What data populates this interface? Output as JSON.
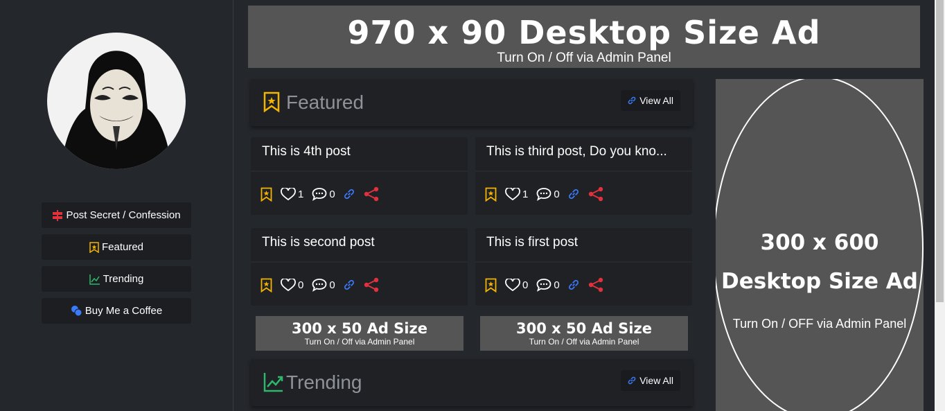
{
  "sidebar": {
    "nav": [
      {
        "label": "Post Secret / Confession",
        "icon": "signpost-icon"
      },
      {
        "label": "Featured",
        "icon": "bookmark-star-icon"
      },
      {
        "label": "Trending",
        "icon": "trending-up-icon"
      },
      {
        "label": "Buy Me a Coffee",
        "icon": "coins-icon"
      }
    ]
  },
  "ads": {
    "top": {
      "title": "970 x 90 Desktop Size Ad",
      "subtitle": "Turn On / Off via Admin Panel"
    },
    "side": {
      "line1": "300 x 600",
      "line2": "Desktop Size Ad",
      "subtitle": "Turn On / OFF via Admin Panel"
    },
    "small": [
      {
        "title": "300 x 50 Ad Size",
        "subtitle": "Turn On / Off via Admin Panel"
      },
      {
        "title": "300 x 50 Ad Size",
        "subtitle": "Turn On / Off via Admin Panel"
      }
    ]
  },
  "featured": {
    "title": "Featured",
    "view_all": "View All",
    "posts": [
      {
        "title": "This is 4th post",
        "likes": "1",
        "comments": "0"
      },
      {
        "title": "This is third post, Do you kno...",
        "likes": "1",
        "comments": "0"
      },
      {
        "title": "This is second post",
        "likes": "0",
        "comments": "0"
      },
      {
        "title": "This is first post",
        "likes": "0",
        "comments": "0"
      }
    ]
  },
  "trending": {
    "title": "Trending",
    "view_all": "View All"
  },
  "colors": {
    "accent_gold": "#f5b400",
    "share_red": "#e0313d",
    "link_blue": "#3a7bfd",
    "trend_green": "#2eb86b"
  }
}
